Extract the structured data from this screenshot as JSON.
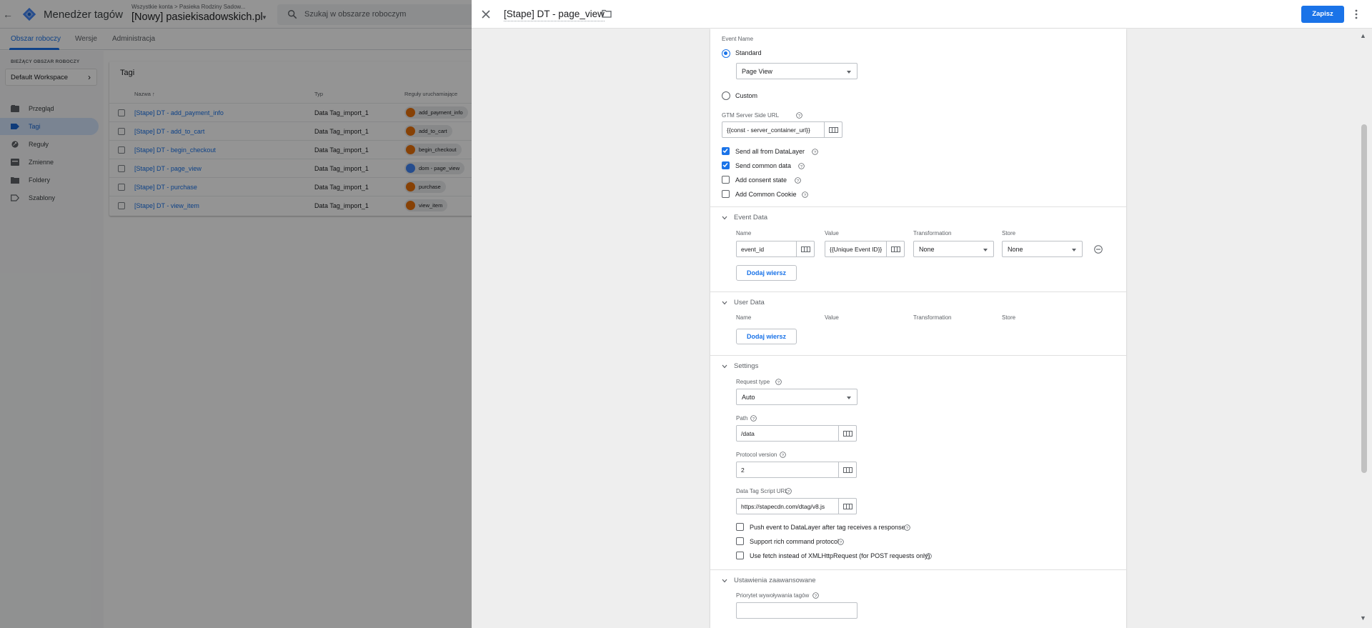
{
  "app": {
    "title": "Menedżer tagów",
    "breadcrumb": "Wszystkie konta > Pasieka Rodziny Sadow...",
    "container": "[Nowy] pasiekisadowskich.pl",
    "search_placeholder": "Szukaj w obszarze roboczym"
  },
  "nav_tabs": [
    "Obszar roboczy",
    "Wersje",
    "Administracja"
  ],
  "workspace": {
    "label": "BIEŻĄCY OBSZAR ROBOCZY",
    "name": "Default Workspace"
  },
  "sidebar": [
    {
      "label": "Przegląd",
      "icon": "overview-icon"
    },
    {
      "label": "Tagi",
      "icon": "tag-icon",
      "active": true
    },
    {
      "label": "Reguły",
      "icon": "trigger-icon"
    },
    {
      "label": "Zmienne",
      "icon": "variable-icon"
    },
    {
      "label": "Foldery",
      "icon": "folder-icon"
    },
    {
      "label": "Szablony",
      "icon": "template-icon"
    }
  ],
  "tags_table": {
    "title": "Tagi",
    "headers": [
      "Nazwa ↑",
      "Typ",
      "Reguły uruchamiające"
    ],
    "rows": [
      {
        "name": "[Stape] DT - add_payment_info",
        "type": "Data Tag_import_1",
        "trigger": "add_payment_info",
        "trigger_color": "#e8710a"
      },
      {
        "name": "[Stape] DT - add_to_cart",
        "type": "Data Tag_import_1",
        "trigger": "add_to_cart",
        "trigger_color": "#e8710a"
      },
      {
        "name": "[Stape] DT - begin_checkout",
        "type": "Data Tag_import_1",
        "trigger": "begin_checkout",
        "trigger_color": "#e8710a"
      },
      {
        "name": "[Stape] DT - page_view",
        "type": "Data Tag_import_1",
        "trigger": "dom - page_view",
        "trigger_color": "#4285f4"
      },
      {
        "name": "[Stape] DT - purchase",
        "type": "Data Tag_import_1",
        "trigger": "purchase",
        "trigger_color": "#e8710a"
      },
      {
        "name": "[Stape] DT - view_item",
        "type": "Data Tag_import_1",
        "trigger": "view_item",
        "trigger_color": "#e8710a"
      }
    ]
  },
  "sheet": {
    "title": "[Stape] DT - page_view",
    "save_label": "Zapisz"
  },
  "form": {
    "event_name_label": "Event Name",
    "standard_label": "Standard",
    "standard_value": "Page View",
    "custom_label": "Custom",
    "gtm_url_label": "GTM Server Side URL",
    "gtm_url_value": "{{const - server_container_url}}",
    "checkboxes": [
      {
        "label": "Send all from DataLayer",
        "checked": true
      },
      {
        "label": "Send common data",
        "checked": true
      },
      {
        "label": "Add consent state",
        "checked": false
      },
      {
        "label": "Add Common Cookie",
        "checked": false
      }
    ],
    "event_data": {
      "title": "Event Data",
      "headers": [
        "Name",
        "Value",
        "Transformation",
        "Store"
      ],
      "row": {
        "name": "event_id",
        "value": "{{Unique Event ID}}",
        "transformation": "None",
        "store": "None"
      },
      "add_row": "Dodaj wiersz"
    },
    "user_data": {
      "title": "User Data",
      "headers": [
        "Name",
        "Value",
        "Transformation",
        "Store"
      ],
      "add_row": "Dodaj wiersz"
    },
    "settings": {
      "title": "Settings",
      "request_type_label": "Request type",
      "request_type_value": "Auto",
      "path_label": "Path",
      "path_value": "/data",
      "protocol_label": "Protocol version",
      "protocol_value": "2",
      "script_url_label": "Data Tag Script URL",
      "script_url_value": "https://stapecdn.com/dtag/v8.js",
      "checkboxes": [
        {
          "label": "Push event to DataLayer after tag receives a response",
          "checked": false
        },
        {
          "label": "Support rich command protocol",
          "checked": false
        },
        {
          "label": "Use fetch instead of XMLHttpRequest (for POST requests only)",
          "checked": false
        }
      ]
    },
    "advanced": {
      "title": "Ustawienia zaawansowane",
      "priority_label": "Priorytet wywoływania tagów"
    }
  }
}
